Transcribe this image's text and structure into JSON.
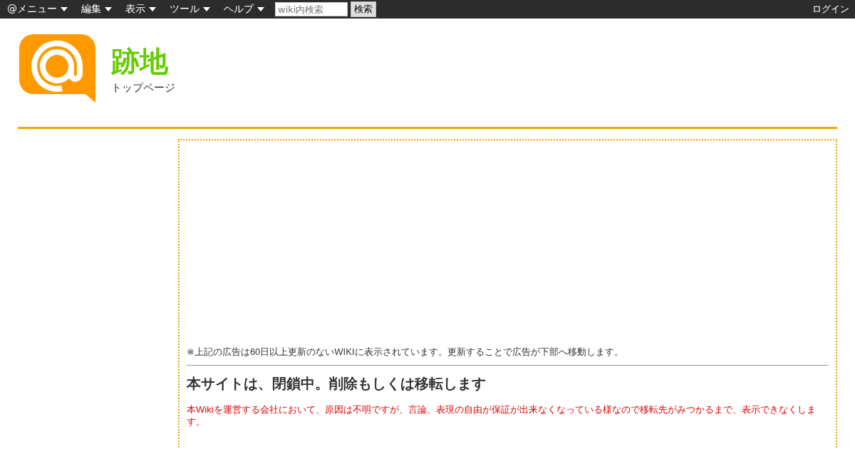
{
  "menu_bar": {
    "items": [
      {
        "label": "@メニュー"
      },
      {
        "label": "編集"
      },
      {
        "label": "表示"
      },
      {
        "label": "ツール"
      },
      {
        "label": "ヘルプ"
      }
    ],
    "search": {
      "placeholder": "wiki内検索",
      "button": "検索"
    },
    "login": "ログイン"
  },
  "header": {
    "title": "跡地",
    "subtitle": "トップページ"
  },
  "content": {
    "ad_notice": "※上記の広告は60日以上更新のないWIKIに表示されています。更新することで広告が下部へ移動します。",
    "heading": "本サイトは、閉鎖中。削除もしくは移転します",
    "message": "本Wikiを運営する会社において、原因は不明ですが、言論、表現の自由が保証が出来なくなっている様なので移転先がみつかるまで、表示できなくします。"
  }
}
